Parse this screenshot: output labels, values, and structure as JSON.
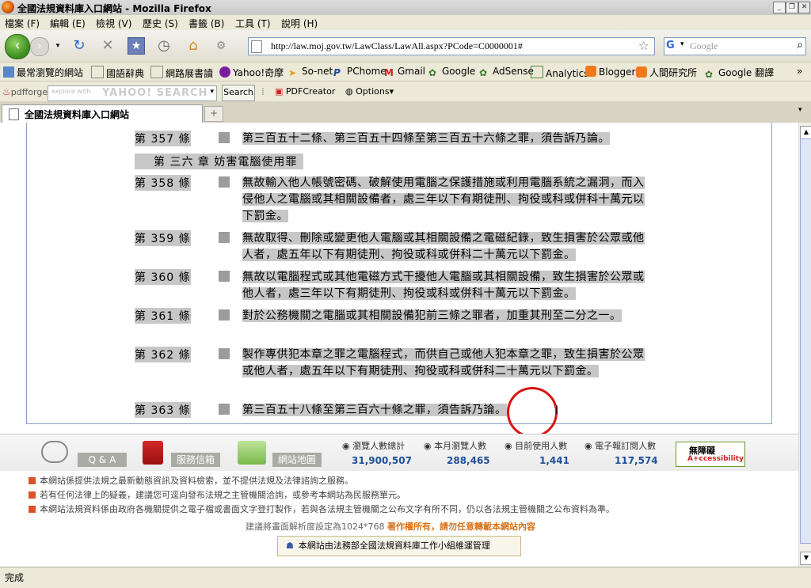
{
  "window": {
    "title": "全國法規資料庫入口網站 - Mozilla Firefox"
  },
  "menu": [
    "檔案 (F)",
    "編輯 (E)",
    "檢視 (V)",
    "歷史 (S)",
    "書籤 (B)",
    "工具 (T)",
    "說明 (H)"
  ],
  "url": "http://law.moj.gov.tw/LawClass/LawAll.aspx?PCode=C0000001#",
  "search": {
    "placeholder": "Google"
  },
  "bookmarks": [
    "最常瀏覽的網站",
    "國語辭典",
    "網路展書讀",
    "Yahoo!奇摩",
    "So-net",
    "PChome",
    "Gmail",
    "Google",
    "AdSense",
    "Analytics",
    "Blogger",
    "人間研究所",
    "Google 翻譯"
  ],
  "yahoo": {
    "brand": "pdfforge",
    "box_hint": "explore with",
    "box_brand": "YAHOO! SEARCH",
    "search_btn": "Search",
    "pdfcreator": "PDFCreator",
    "options": "Options"
  },
  "tab": {
    "title": "全國法規資料庫入口網站"
  },
  "law": {
    "rows": [
      {
        "article": "第 357 條",
        "text": "第三百五十二條、第三百五十四條至第三百五十六條之罪，須告訴乃論。"
      },
      {
        "article": "第 358 條",
        "text": "無故輸入他人帳號密碼、破解使用電腦之保護措施或利用電腦系統之漏洞，而入侵他人之電腦或其相關設備者，處三年以下有期徒刑、拘役或科或併科十萬元以下罰金。"
      },
      {
        "article": "第 359 條",
        "text": "無故取得、刪除或變更他人電腦或其相關設備之電磁紀錄，致生損害於公眾或他人者，處五年以下有期徒刑、拘役或科或併科二十萬元以下罰金。"
      },
      {
        "article": "第 360 條",
        "text": "無故以電腦程式或其他電磁方式干擾他人電腦或其相關設備，致生損害於公眾或他人者，處三年以下有期徒刑、拘役或科或併科十萬元以下罰金。"
      },
      {
        "article": "第 361 條",
        "text": "對於公務機關之電腦或其相關設備犯前三條之罪者，加重其刑至二分之一。"
      },
      {
        "article": "第 362 條",
        "text": "製作專供犯本章之罪之電腦程式，而供自己或他人犯本章之罪，致生損害於公眾或他人者，處五年以下有期徒刑、拘役或科或併科二十萬元以下罰金。"
      },
      {
        "article": "第 363 條",
        "text": "第三百五十八條至第三百六十條之罪，須告訴乃論。"
      }
    ],
    "chapter": "第 三六 章 妨害電腦使用罪"
  },
  "footer": {
    "qa": "Q & A",
    "mail": "服務信箱",
    "sitemap": "網站地圖",
    "stats": [
      {
        "label": "瀏覽人數總計",
        "value": "31,900,507"
      },
      {
        "label": "本月瀏覽人數",
        "value": "288,465"
      },
      {
        "label": "目前使用人數",
        "value": "1,441"
      },
      {
        "label": "電子報訂閱人數",
        "value": "117,574"
      }
    ],
    "access_top": "無障礙",
    "access_bottom": "A+ccessibility",
    "notes": [
      "本網站係提供法規之最新動態資訊及資料檢索，並不提供法規及法律諮詢之服務。",
      "若有任何法律上的疑義，建議您可逕向發布法規之主管機關洽詢，或參考本網站為民服務單元。",
      "本網站法規資料係由政府各機關提供之電子檔或書面文字登打製作，若與各法規主管機關之公布文字有所不同，仍以各法規主管機關之公布資料為準。"
    ],
    "resolution": "建議將畫面解析度設定為1024*768",
    "copyright": "著作權所有，請勿任意轉載本網站內容",
    "manager": "本網站由法務部全國法規資料庫工作小組維運管理"
  },
  "status": "完成"
}
